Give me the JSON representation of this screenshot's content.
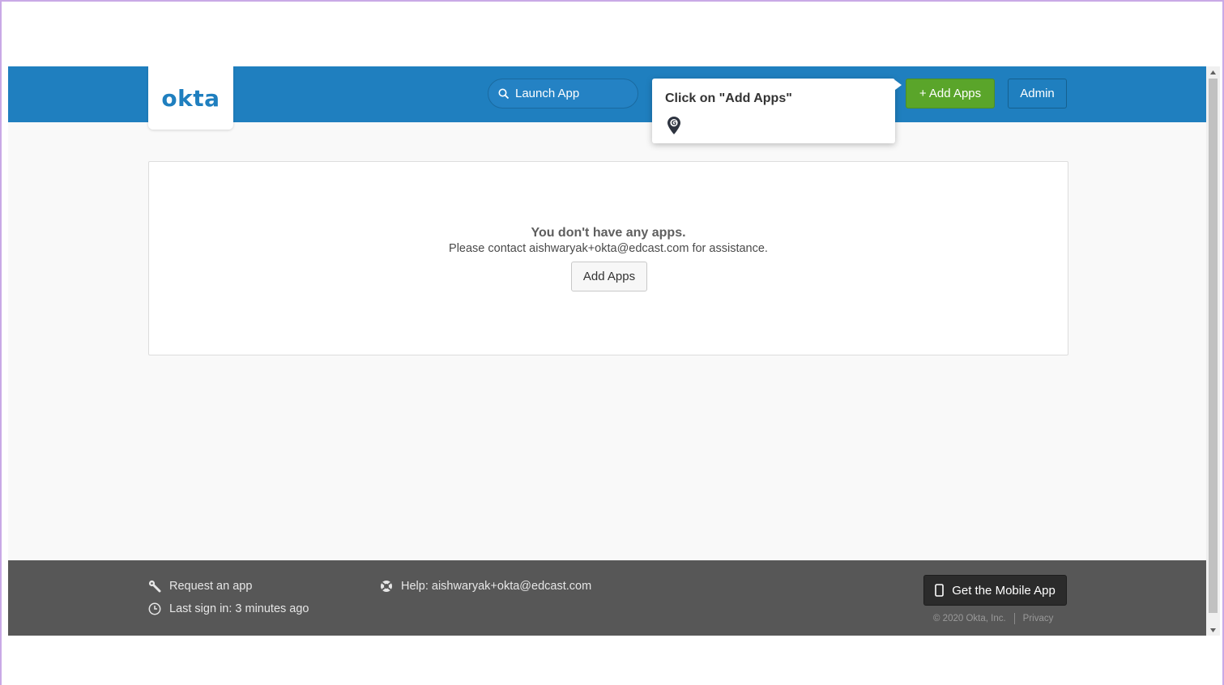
{
  "header": {
    "logo_text": "okta",
    "search_placeholder": "Launch App",
    "add_apps_label": "+ Add Apps",
    "admin_label": "Admin"
  },
  "tooltip": {
    "text": "Click on \"Add Apps\"",
    "icon": "guide-pin-icon"
  },
  "main": {
    "empty_title": "You don't have any apps.",
    "empty_subtitle": "Please contact aishwaryak+okta@edcast.com for assistance.",
    "add_apps_button": "Add Apps"
  },
  "footer": {
    "request_app": "Request an app",
    "last_sign_in": "Last sign in: 3 minutes ago",
    "help": "Help: aishwaryak+okta@edcast.com",
    "mobile_app_button": "Get the Mobile App",
    "copyright": "© 2020 Okta, Inc.",
    "privacy": "Privacy"
  },
  "colors": {
    "brand_blue": "#1f7fbf",
    "add_green": "#5aa52a",
    "footer_gray": "#575757"
  }
}
